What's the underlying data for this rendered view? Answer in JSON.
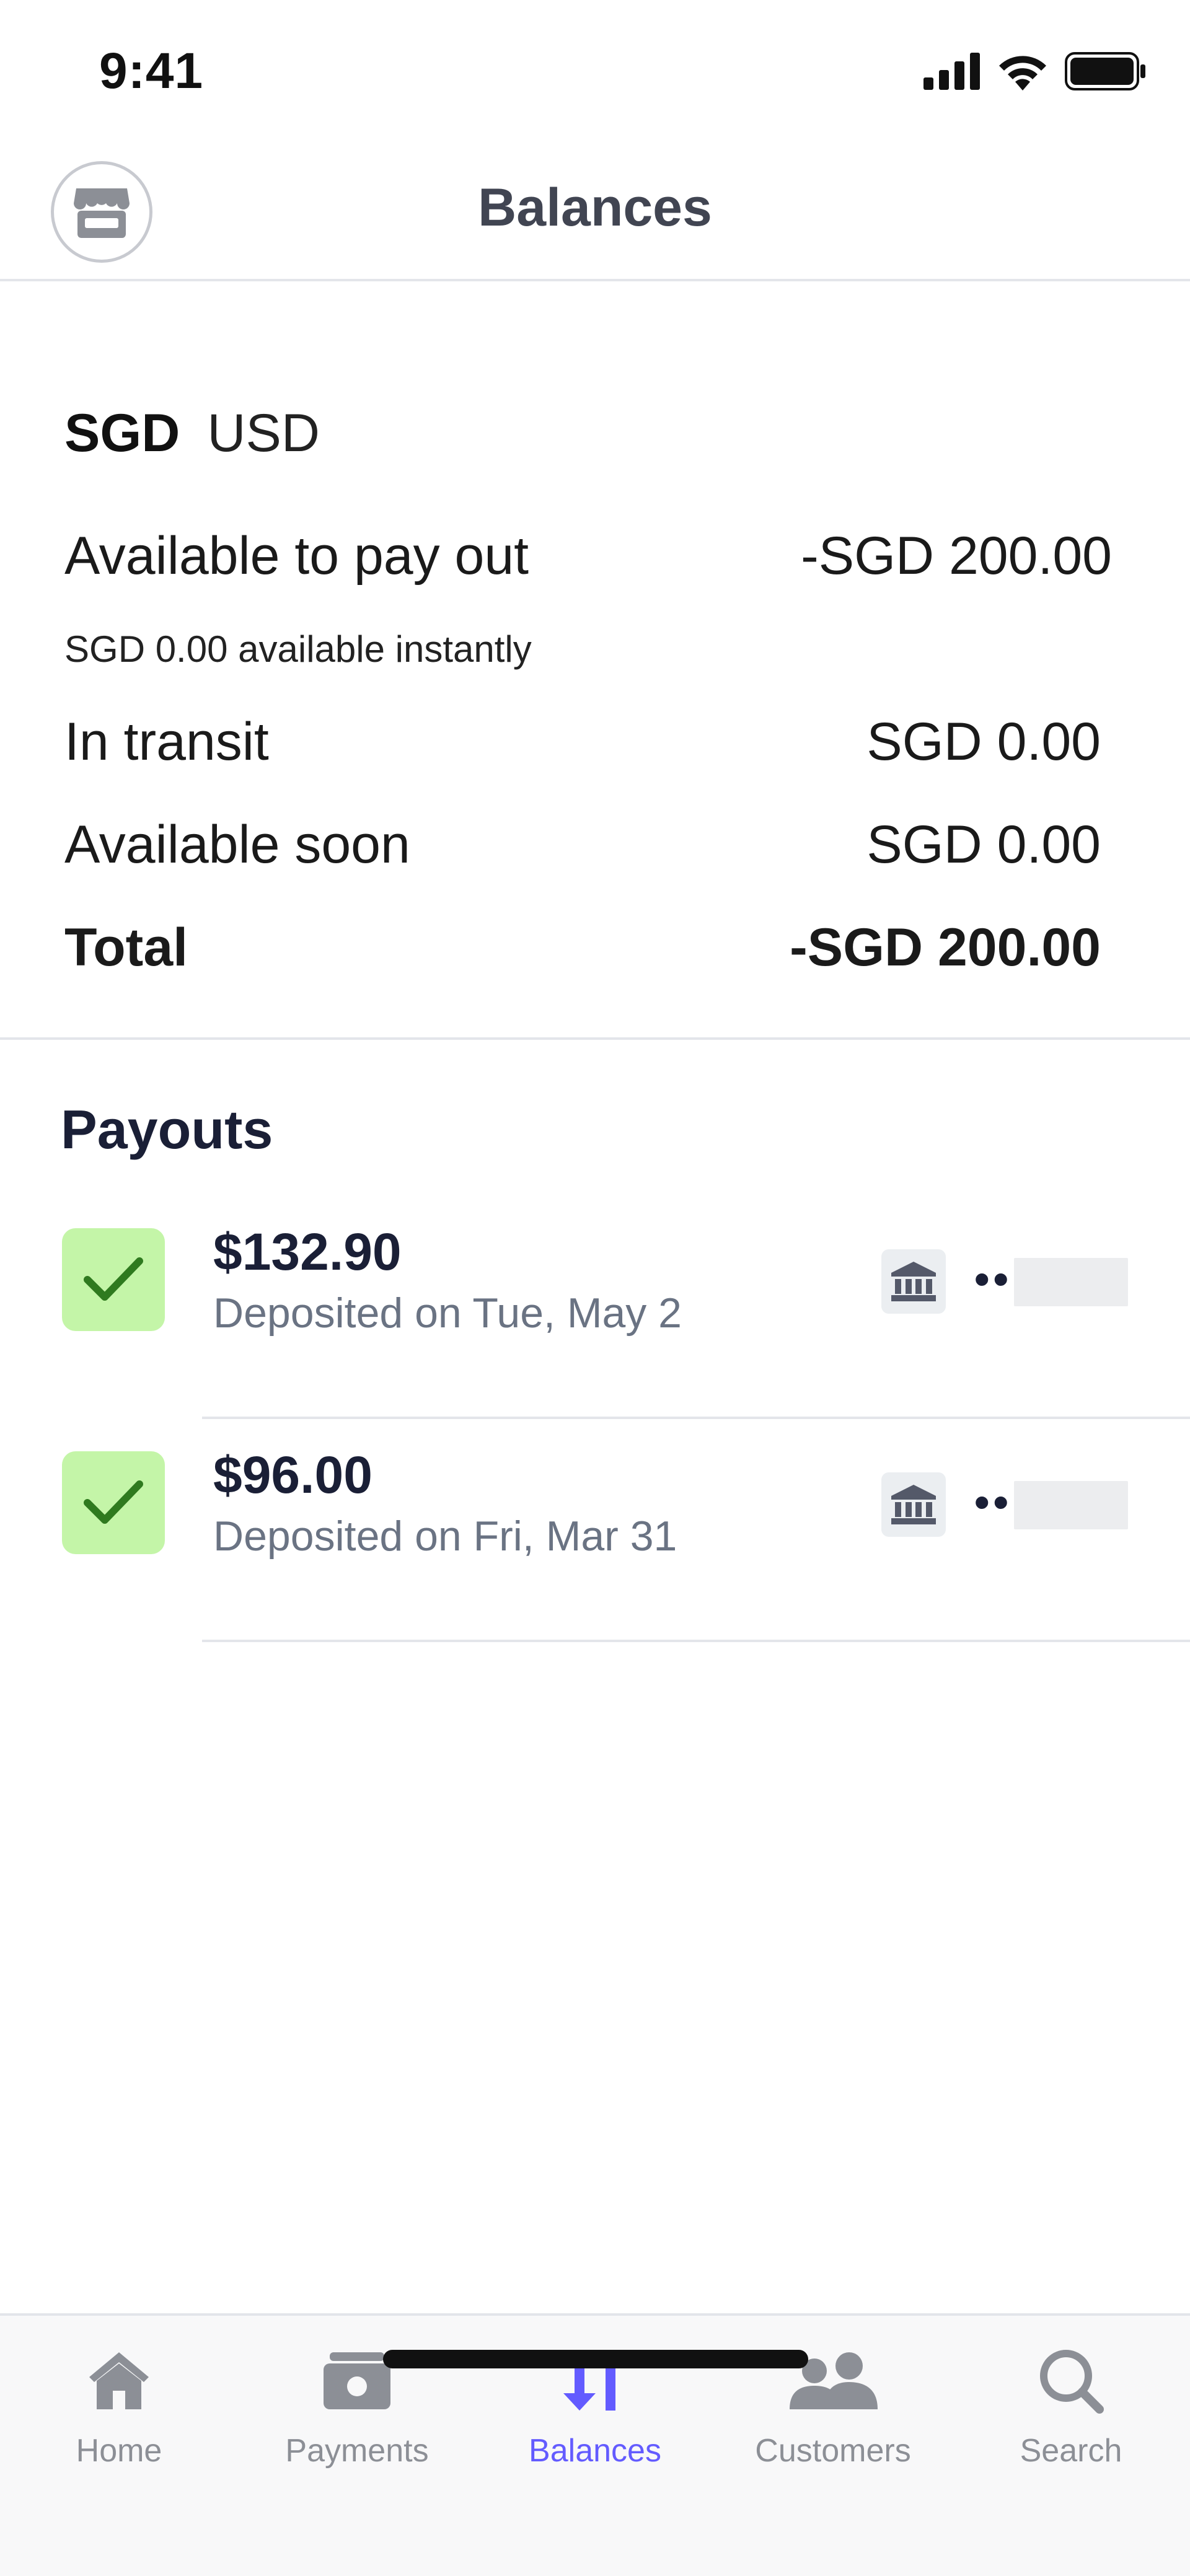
{
  "status_bar": {
    "time": "9:41"
  },
  "header": {
    "title": "Balances",
    "store_icon": "store-icon"
  },
  "currencies": {
    "active": "SGD",
    "other": "USD"
  },
  "balances": {
    "available_label": "Available to pay out",
    "available_value": "-SGD 200.00",
    "instant_note": "SGD 0.00 available instantly",
    "transit_label": "In transit",
    "transit_value": "SGD 0.00",
    "soon_label": "Available soon",
    "soon_value": "SGD 0.00",
    "total_label": "Total",
    "total_value": "-SGD 200.00"
  },
  "payouts": {
    "title": "Payouts",
    "items": [
      {
        "amount": "$132.90",
        "date": "Deposited on Tue, May 2",
        "acct_prefix": "••"
      },
      {
        "amount": "$96.00",
        "date": "Deposited on Fri, Mar 31",
        "acct_prefix": "••"
      }
    ]
  },
  "tabs": [
    {
      "label": "Home",
      "icon": "home-icon"
    },
    {
      "label": "Payments",
      "icon": "payments-icon"
    },
    {
      "label": "Balances",
      "icon": "balances-icon"
    },
    {
      "label": "Customers",
      "icon": "customers-icon"
    },
    {
      "label": "Search",
      "icon": "search-icon"
    }
  ],
  "colors": {
    "accent": "#635bff",
    "success_bg": "#c4f5a8",
    "success_check": "#2f7a1f",
    "muted": "#8c8f96"
  }
}
